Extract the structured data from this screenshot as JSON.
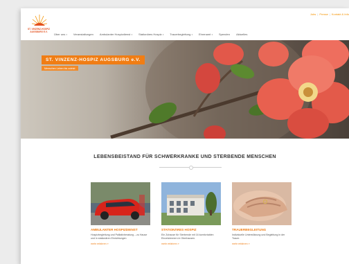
{
  "topbar": {
    "links": [
      "Jobs",
      "Presse",
      "Kontakt & Info"
    ]
  },
  "logo": {
    "line1": "ST. VINZENZ-HOSPIZ",
    "line2": "AUGSBURG E.V."
  },
  "nav": {
    "items": [
      {
        "label": "Über uns",
        "dropdown": true
      },
      {
        "label": "Veranstaltungen",
        "dropdown": false
      },
      {
        "label": "Ambulanter Hospizdienst",
        "dropdown": true
      },
      {
        "label": "Stationäres Hospiz",
        "dropdown": true
      },
      {
        "label": "Trauerbegleitung",
        "dropdown": true
      },
      {
        "label": "Ehrenamt",
        "dropdown": true
      },
      {
        "label": "Spenden",
        "dropdown": false
      },
      {
        "label": "Aktuelles",
        "dropdown": false
      }
    ]
  },
  "hero": {
    "title": "ST. VINZENZ-HOSPIZ AUGSBURG e.V.",
    "subtitle": "Menschen Leben bis zuletzt"
  },
  "section": {
    "title": "LEBENSBEISTAND FÜR SCHWERKRANKE UND STERBENDE MENSCHEN"
  },
  "cards": [
    {
      "title": "AMBULANTER HOSPIZDIENST",
      "text": "Hospizbegleitung und Palliativberatung – zu Hause und in stationären Einrichtungen",
      "more": "mehr erfahren »"
    },
    {
      "title": "STATIONÄRES HOSPIZ",
      "text": "Ein Zuhause für Sterbende mit 16 komfortablen Einzelzimmern in Oberhausen.",
      "more": "mehr erfahren »"
    },
    {
      "title": "TRAUERBEGLEITUNG",
      "text": "Individuelle Unterstützung und Begleitung in der Trauer.",
      "more": "mehr erfahren »"
    }
  ],
  "colors": {
    "accent": "#f07d14",
    "logo": "#e34f1b"
  }
}
